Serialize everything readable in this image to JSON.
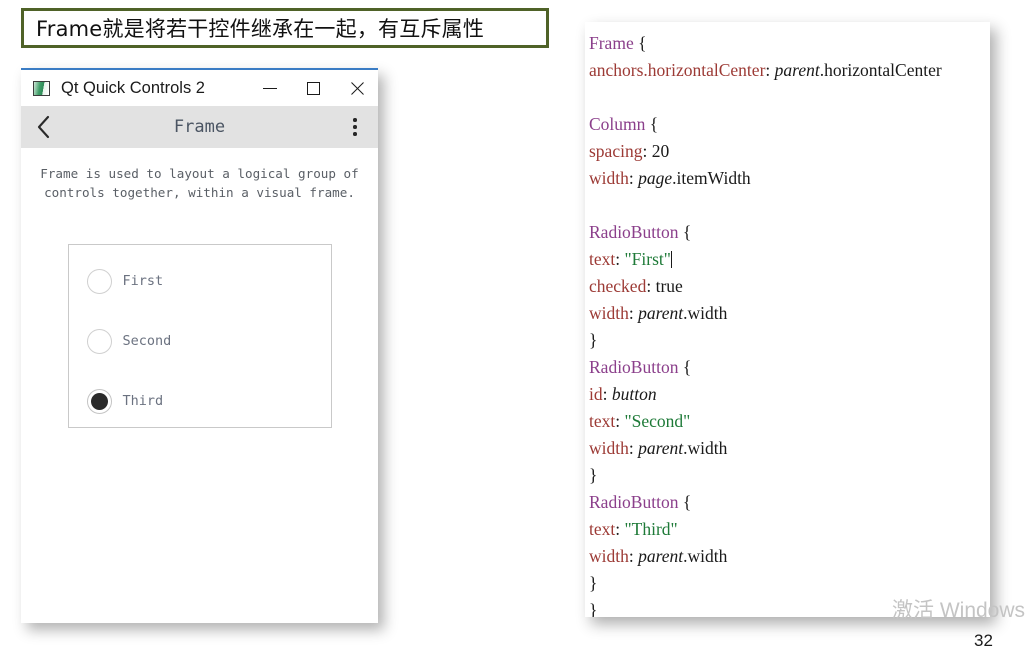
{
  "caption": {
    "text": "Frame就是将若干控件继承在一起，有互斥属性",
    "border_color": "#4f6228"
  },
  "qt_window": {
    "titlebar": {
      "app_icon": "qt-app-icon",
      "title": "Qt Quick Controls 2",
      "buttons": {
        "minimize": "—",
        "maximize": "□",
        "close": "✕"
      }
    },
    "toolbar": {
      "back_label": "‹",
      "title": "Frame",
      "menu_label": "⋮"
    },
    "description": "Frame is used to layout a logical group of\ncontrols together, within a visual frame.",
    "frame": {
      "radios": [
        {
          "label": "First",
          "checked": false
        },
        {
          "label": "Second",
          "checked": false
        },
        {
          "label": "Third",
          "checked": true
        }
      ]
    }
  },
  "code_panel": {
    "language": "qml",
    "colors": {
      "type": "#8b3f8b",
      "property": "#9c3a35",
      "string": "#1e7a38",
      "value": "#1a1a1a"
    },
    "lines": [
      [
        {
          "t": "type",
          "v": "Frame"
        },
        {
          "t": "punct",
          "v": " {"
        }
      ],
      [
        {
          "t": "prop",
          "v": "anchors.horizontalCenter"
        },
        {
          "t": "punct",
          "v": ": "
        },
        {
          "t": "ref",
          "v": "parent"
        },
        {
          "t": "val",
          "v": ".horizontalCenter"
        }
      ],
      [],
      [
        {
          "t": "type",
          "v": "Column"
        },
        {
          "t": "punct",
          "v": " {"
        }
      ],
      [
        {
          "t": "prop",
          "v": "spacing"
        },
        {
          "t": "punct",
          "v": ": "
        },
        {
          "t": "val",
          "v": "20"
        }
      ],
      [
        {
          "t": "prop",
          "v": "width"
        },
        {
          "t": "punct",
          "v": ": "
        },
        {
          "t": "ref",
          "v": "page"
        },
        {
          "t": "val",
          "v": ".itemWidth"
        }
      ],
      [],
      [
        {
          "t": "type",
          "v": "RadioButton"
        },
        {
          "t": "punct",
          "v": " {"
        }
      ],
      [
        {
          "t": "prop",
          "v": "text"
        },
        {
          "t": "punct",
          "v": ": "
        },
        {
          "t": "str",
          "v": "\"First\""
        },
        {
          "t": "caret",
          "v": ""
        }
      ],
      [
        {
          "t": "prop",
          "v": "checked"
        },
        {
          "t": "punct",
          "v": ": "
        },
        {
          "t": "val",
          "v": "true"
        }
      ],
      [
        {
          "t": "prop",
          "v": "width"
        },
        {
          "t": "punct",
          "v": ": "
        },
        {
          "t": "ref",
          "v": "parent"
        },
        {
          "t": "val",
          "v": ".width"
        }
      ],
      [
        {
          "t": "punct",
          "v": "}"
        }
      ],
      [
        {
          "t": "type",
          "v": "RadioButton"
        },
        {
          "t": "punct",
          "v": " {"
        }
      ],
      [
        {
          "t": "prop",
          "v": "id"
        },
        {
          "t": "punct",
          "v": ": "
        },
        {
          "t": "ref",
          "v": "button"
        }
      ],
      [
        {
          "t": "prop",
          "v": "text"
        },
        {
          "t": "punct",
          "v": ": "
        },
        {
          "t": "str",
          "v": "\"Second\""
        }
      ],
      [
        {
          "t": "prop",
          "v": "width"
        },
        {
          "t": "punct",
          "v": ": "
        },
        {
          "t": "ref",
          "v": "parent"
        },
        {
          "t": "val",
          "v": ".width"
        }
      ],
      [
        {
          "t": "punct",
          "v": "}"
        }
      ],
      [
        {
          "t": "type",
          "v": "RadioButton"
        },
        {
          "t": "punct",
          "v": " {"
        }
      ],
      [
        {
          "t": "prop",
          "v": "text"
        },
        {
          "t": "punct",
          "v": ": "
        },
        {
          "t": "str",
          "v": "\"Third\""
        }
      ],
      [
        {
          "t": "prop",
          "v": "width"
        },
        {
          "t": "punct",
          "v": ": "
        },
        {
          "t": "ref",
          "v": "parent"
        },
        {
          "t": "val",
          "v": ".width"
        }
      ],
      [
        {
          "t": "punct",
          "v": "}"
        }
      ],
      [
        {
          "t": "punct",
          "v": "}"
        }
      ],
      [
        {
          "t": "punct",
          "v": "}"
        }
      ]
    ]
  },
  "watermark": {
    "text": "激活 Windows"
  },
  "page_number": "32"
}
